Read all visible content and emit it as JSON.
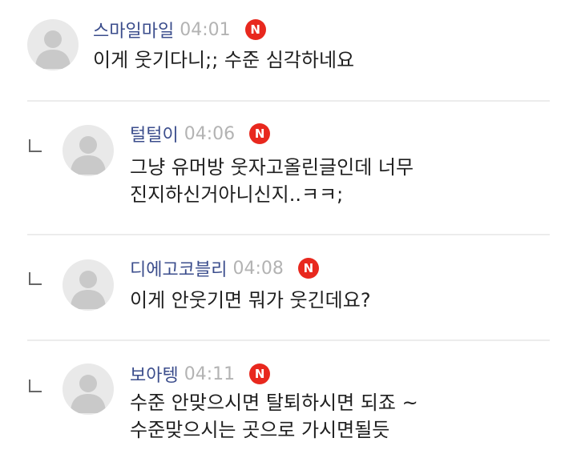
{
  "comments": [
    {
      "author": "스마일마일",
      "time": "04:01",
      "badge": "N",
      "icon": "default-profile-icon",
      "lines": [
        "이게 웃기다니;; 수준 심각하네요"
      ]
    },
    {
      "author": "털털이",
      "time": "04:06",
      "badge": "N",
      "icon": "default-profile-icon",
      "lines": [
        "그냥 유머방 웃자고올린글인데 너무",
        "진지하신거아니신지..ㅋㅋ;"
      ]
    },
    {
      "author": "디에고코블리",
      "time": "04:08",
      "badge": "N",
      "icon": "default-profile-icon",
      "lines": [
        "이게 안웃기면 뭐가 웃긴데요?"
      ]
    },
    {
      "author": "보아텡",
      "time": "04:11",
      "badge": "N",
      "icon": "default-profile-icon",
      "lines": [
        "수준 안맞으시면 탈퇴하시면 되죠 ~",
        "수준맞으시는 곳으로 가시면될듯"
      ]
    }
  ],
  "colors": {
    "author": "#3b4d8c",
    "time": "#b3b3b3",
    "badge": "#e8281e",
    "text": "#1f1f1f",
    "divider": "#ececec"
  }
}
